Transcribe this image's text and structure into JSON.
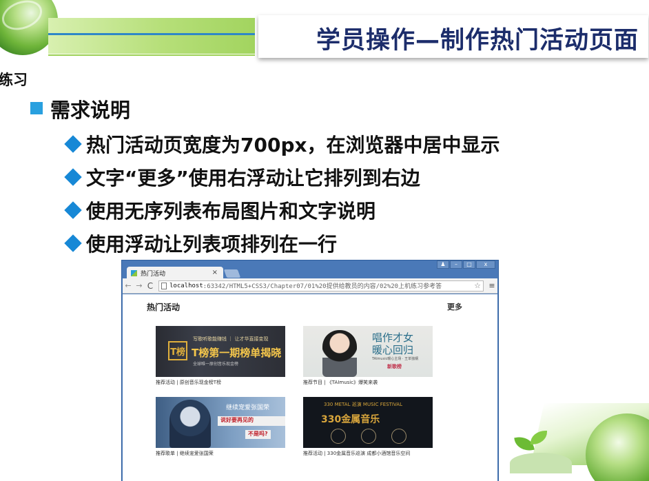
{
  "slide": {
    "title": "学员操作—制作热门活动页面",
    "corner_label": "练习",
    "section_heading": "需求说明",
    "requirements": [
      "热门活动页宽度为700px，在浏览器中居中显示",
      "文字“更多”使用右浮动让它排列到右边",
      "使用无序列表布局图片和文字说明",
      "使用浮动让列表项排列在一行"
    ]
  },
  "colors": {
    "title_text": "#1c2d6b",
    "bullet_square": "#29a0df",
    "bullet_diamond": "#1788d6",
    "browser_frame": "#4a79b8"
  },
  "browser": {
    "tab_title": "热门活动",
    "tab_close": "×",
    "window_controls": [
      "♟",
      "–",
      "□",
      "x"
    ],
    "back": "←",
    "forward": "→",
    "reload": "C",
    "star": "☆",
    "menu": "≡",
    "url_host": "localhost",
    "url_rest": ":63342/HTML5+CSS3/Chapter07/01%20提供给教员的内容/02%20上机练习参考答",
    "page": {
      "heading": "热门活动",
      "more": "更多",
      "activities": [
        {
          "caption": "推荐活动 | 原创音乐现金榜T榜",
          "thumb": {
            "logo": "T榜",
            "small": "写歌听歌能赚钱 ｜ 让才华直接变现",
            "big": "T榜第一期榜单揭晓",
            "sub": "全球唯一原创音乐现金榜"
          }
        },
        {
          "caption": "推荐节目 | 《TAImusic》爆笑来袭",
          "thumb": {
            "line1": "唱作才女",
            "line2": "暖心回归",
            "meta": "TAImusic暖心主场 · 王单独钢",
            "stamp": "新歌榜"
          }
        },
        {
          "caption": "推荐歌单 | 继续宠爱张国荣",
          "thumb": {
            "line1": "继续宠爱张国荣",
            "line2": "说好要再见的",
            "line3": "不是吗?"
          }
        },
        {
          "caption": "推荐活动 | 330金属音乐巡演 成都小酒馆音乐空间",
          "thumb": {
            "top": "330 METAL 巡演 MUSIC FESTIVAL",
            "mid": "330金属音乐"
          }
        }
      ]
    }
  }
}
